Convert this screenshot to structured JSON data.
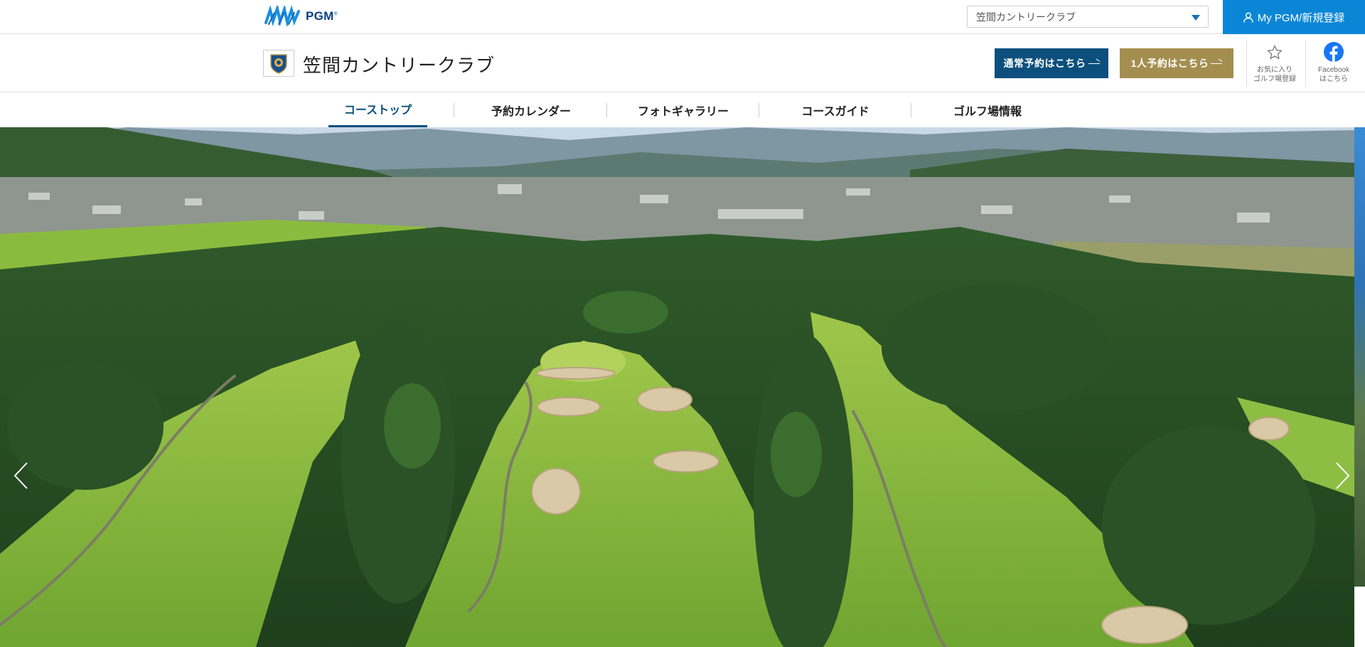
{
  "topbar": {
    "logo_text": "PGM",
    "logo_reg": "®",
    "course_select_value": "笠間カントリークラブ",
    "mypgm_label": "My PGM/新規登録"
  },
  "header": {
    "course_name": "笠間カントリークラブ",
    "btn_normal": "通常予約はこちら",
    "btn_solo": "1人予約はこちら",
    "fav_line1": "お気に入り",
    "fav_line2": "ゴルフ場登録",
    "fb_line1": "Facebook",
    "fb_line2": "はこちら"
  },
  "nav": {
    "items": [
      {
        "label": "コーストップ",
        "active": true
      },
      {
        "label": "予約カレンダー",
        "active": false
      },
      {
        "label": "フォトギャラリー",
        "active": false
      },
      {
        "label": "コースガイド",
        "active": false
      },
      {
        "label": "ゴルフ場情報",
        "active": false
      }
    ]
  },
  "colors": {
    "brand_blue": "#0b86d6",
    "reserve_navy": "#0c4f7d",
    "reserve_gold": "#a48e4f",
    "facebook_blue": "#1877f2"
  },
  "icons": {
    "user": "user-icon",
    "star": "star-icon",
    "facebook": "facebook-icon",
    "prev": "chevron-left-icon",
    "next": "chevron-right-icon"
  }
}
